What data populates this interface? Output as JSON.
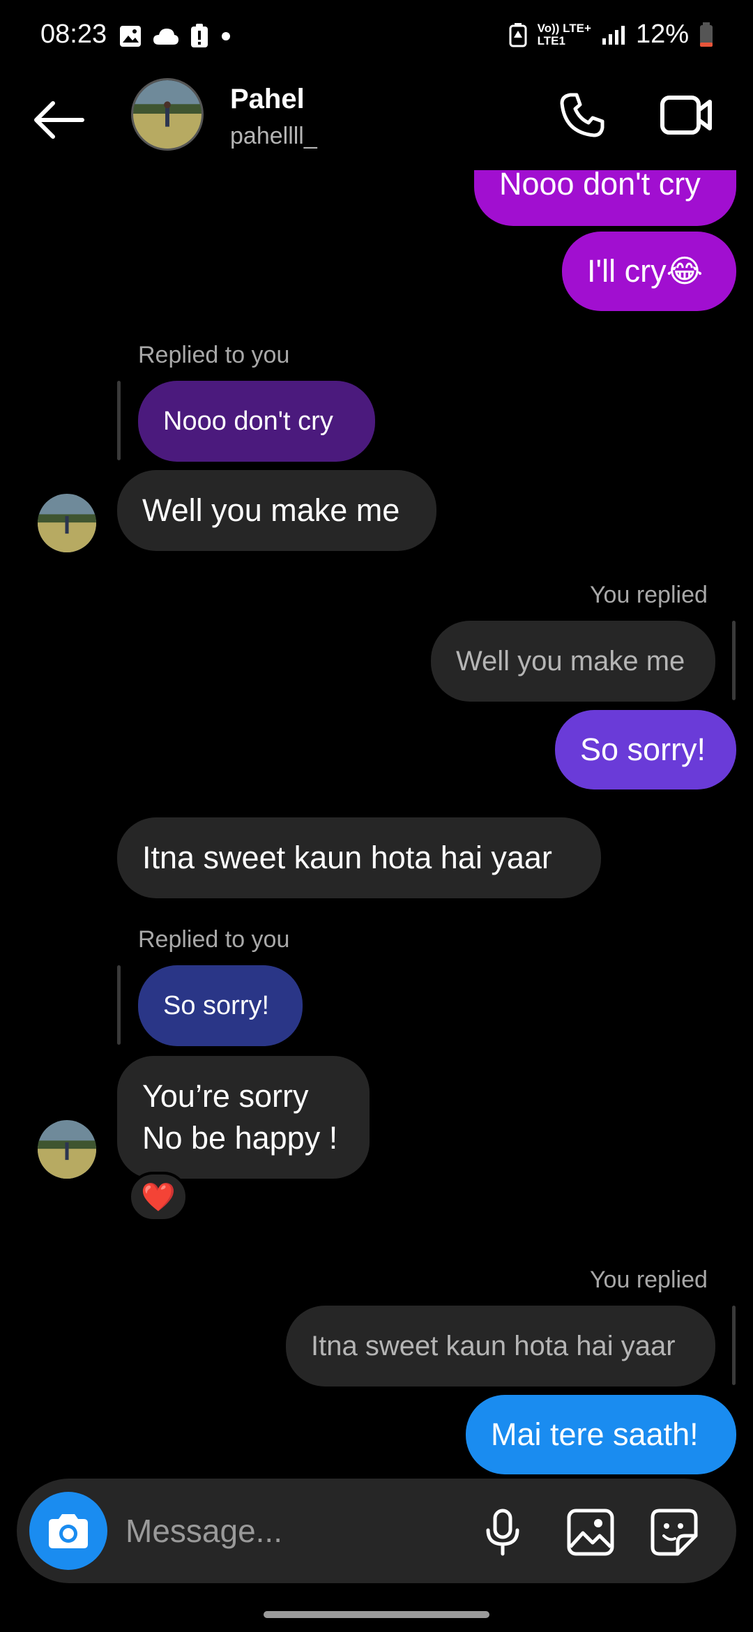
{
  "status_bar": {
    "time": "08:23",
    "network_top": "Vo)) LTE+",
    "network_bottom": "LTE1",
    "battery": "12%",
    "icons_left": [
      "gallery-icon",
      "cloud-icon",
      "alert-icon",
      "dot-icon"
    ],
    "icons_right": [
      "battery-saver-icon",
      "signal-icon",
      "battery-icon"
    ]
  },
  "header": {
    "name": "Pahel",
    "username": "pahellll_",
    "icons": [
      "back-arrow-icon",
      "phone-icon",
      "video-camera-icon"
    ]
  },
  "messages": {
    "m1": "Nooo don't cry",
    "m2": "I'll cry😂",
    "reply1_label": "Replied to you",
    "reply1_quote": "Nooo don't cry",
    "m3": "Well you make me",
    "reply2_label": "You replied",
    "reply2_quote": "Well you make me",
    "m4": "So sorry!",
    "m5": "Itna sweet kaun hota hai yaar",
    "reply3_label": "Replied to you",
    "reply3_quote": "So sorry!",
    "m6_line1": "You’re sorry",
    "m6_line2": "No be happy !",
    "m6_reaction": "❤️",
    "reply4_label": "You replied",
    "reply4_quote": "Itna sweet kaun hota hai yaar",
    "m7": "Mai tere saath!"
  },
  "composer": {
    "placeholder": "Message...",
    "icons": [
      "camera-icon",
      "microphone-icon",
      "image-icon",
      "sticker-icon"
    ]
  },
  "colors": {
    "sent_purple": "#a10fd0",
    "sent_indigo": "#6a3bd8",
    "sent_blue": "#1a8cf0",
    "received": "#262626",
    "quote_purple": "#4b1a7d",
    "quote_navy": "#2a3687"
  }
}
